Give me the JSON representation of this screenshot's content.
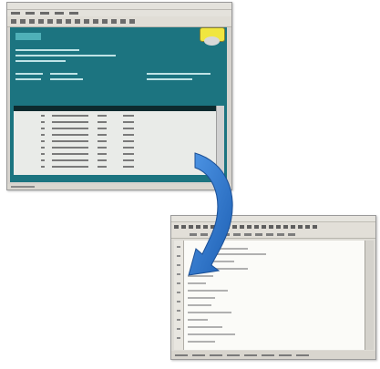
{
  "colors": {
    "legacy_screen_bg": "#1c7480",
    "legacy_title_text": "#fff36a",
    "arrow_blue": "#2b72c8",
    "window_chrome": "#d6d3ce"
  },
  "illustration": {
    "arrow_icon": "curved-arrow-down-left"
  }
}
